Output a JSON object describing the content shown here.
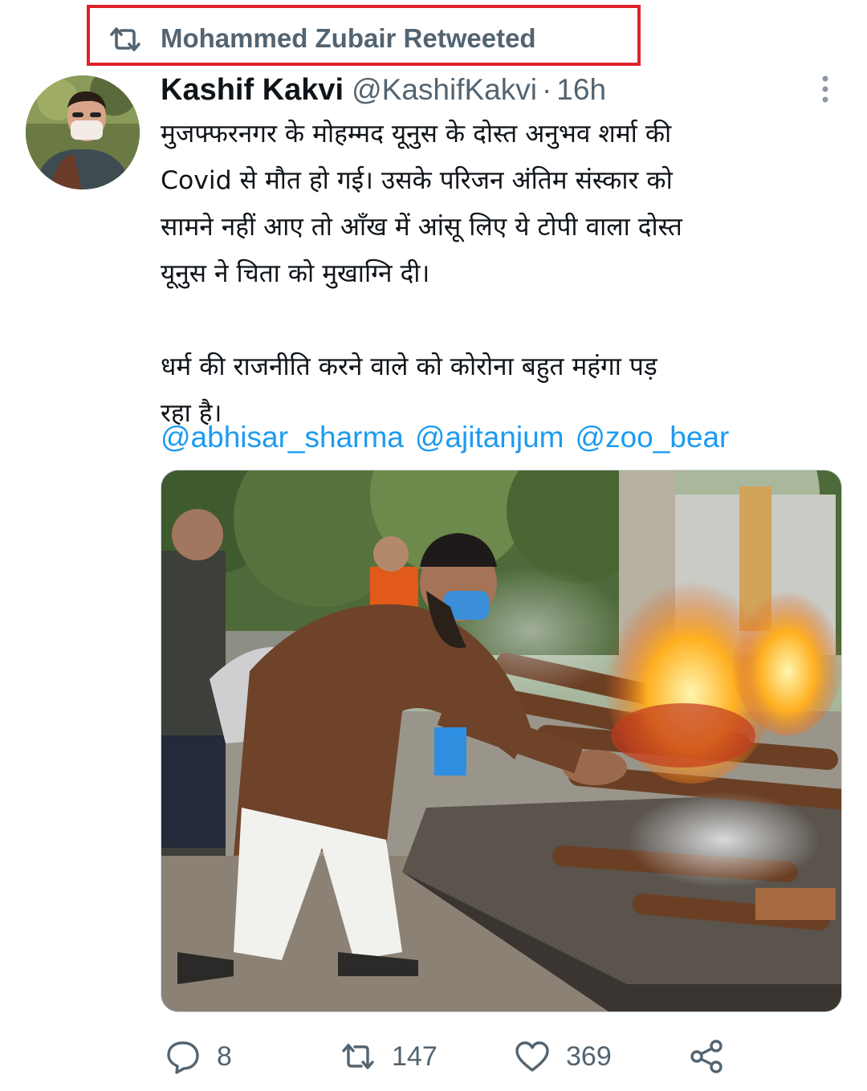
{
  "retweet_banner": {
    "text": "Mohammed Zubair Retweeted",
    "highlight_color": "#e0212b"
  },
  "tweet": {
    "author_name": "Kashif Kakvi",
    "author_handle": "@KashifKakvi",
    "separator": "·",
    "time": "16h",
    "text": "मुजफ्फरनगर के मोहम्मद यूनुस के दोस्त अनुभव शर्मा की\nCovid से मौत हो गई। उसके परिजन अंतिम संस्कार को\nसामने नहीं आए तो आँख में आंसू लिए ये टोपी वाला दोस्त\nयूनुस ने चिता को मुखाग्नि दी।\n\nधर्म की राजनीति करने वाले को कोरोना बहुत महंगा पड़\nरहा है।",
    "mentions": [
      "@abhisar_sharma",
      "@ajitanjum",
      "@zoo_bear"
    ],
    "link_color": "#1d9bf0"
  },
  "actions": {
    "reply_count": "8",
    "retweet_count": "147",
    "like_count": "369"
  },
  "colors": {
    "secondary_text": "#536471",
    "primary_text": "#0f1419"
  }
}
